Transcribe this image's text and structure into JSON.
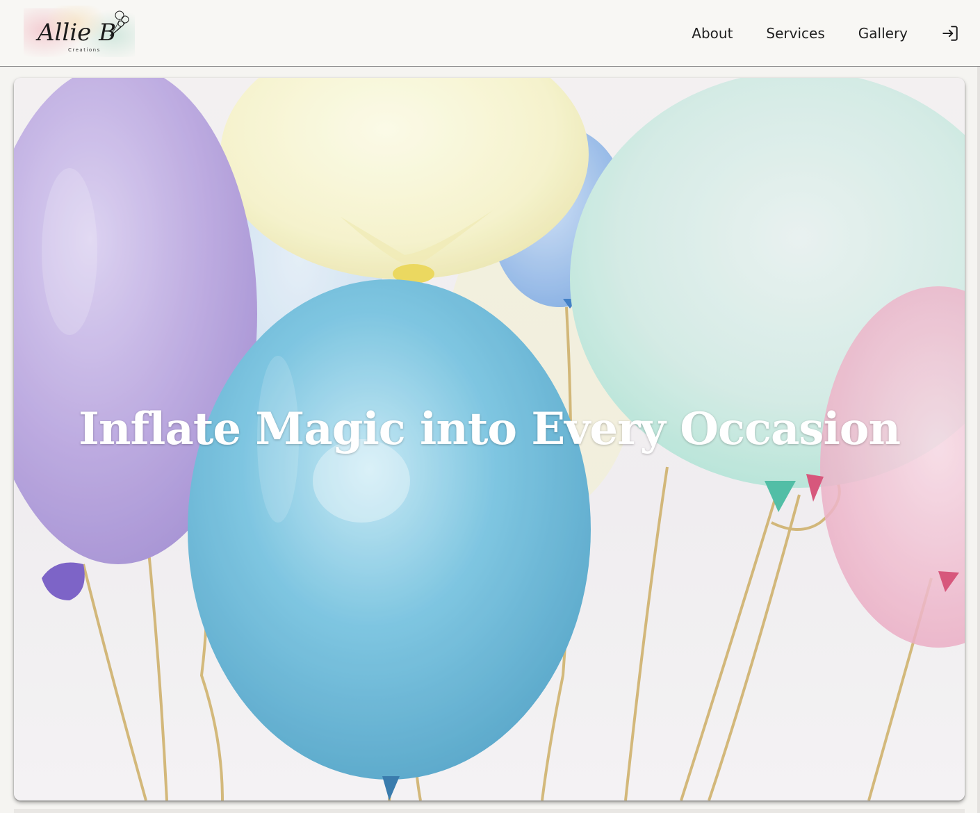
{
  "brand": {
    "logo_text": "Allie B",
    "logo_tagline": "Creations"
  },
  "nav": {
    "items": [
      {
        "label": "About"
      },
      {
        "label": "Services"
      },
      {
        "label": "Gallery"
      }
    ],
    "login_icon": "login-icon"
  },
  "hero": {
    "title": "Inflate Magic into Every Occasion",
    "image": "pastel-balloons-image"
  },
  "colors": {
    "nav_bg": "#f8f7f4",
    "text": "#1f1f1f",
    "hero_title": "#ffffff",
    "balloon_purple": "#b7a3de",
    "balloon_yellow": "#f4f1c6",
    "balloon_blue": "#5fb4d6",
    "balloon_mint": "#c9ece2",
    "balloon_pink": "#eaa5bd",
    "ribbon_gold": "#c9a85a"
  }
}
